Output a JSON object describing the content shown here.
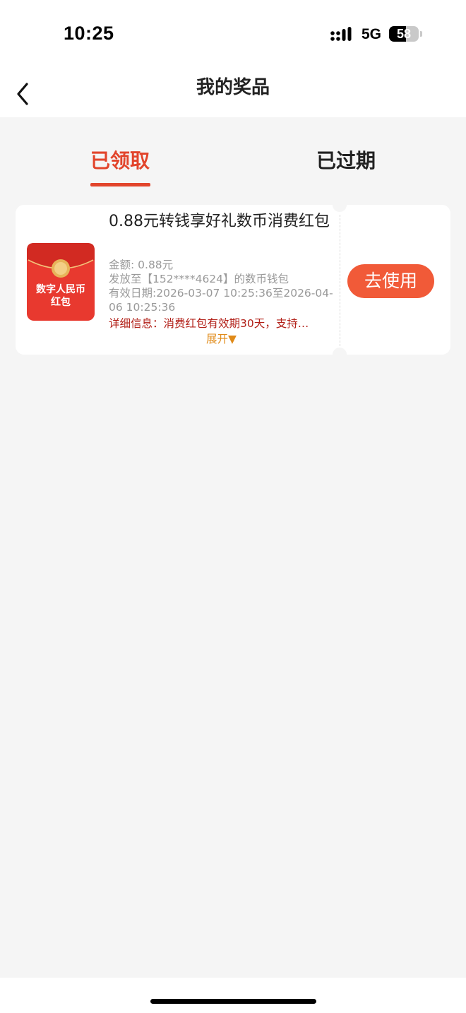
{
  "status_bar": {
    "time": "10:25",
    "network": "5G",
    "battery_level": "58",
    "battery_fraction": 0.58,
    "signal_icon": "signal-bars-icon"
  },
  "nav": {
    "back_icon": "chevron-left-icon",
    "title": "我的奖品"
  },
  "tabs": [
    {
      "label": "已领取",
      "active": true
    },
    {
      "label": "已过期",
      "active": false
    }
  ],
  "coupon": {
    "image_label_line1": "数字人民币",
    "image_label_line2": "红包",
    "title": "0.88元转钱享好礼数币消费红包",
    "amount": "金额: 0.88元",
    "wallet": "发放至【152****4624】的数币钱包",
    "validity": "有效日期:2026-03-07 10:25:36至2026-04-06 10:25:36",
    "detail": "详细信息：消费红包有效期30天，支持…",
    "expand_label": "展开▼",
    "use_button": "去使用"
  },
  "colors": {
    "accent": "#e2452c",
    "button": "#f15a38",
    "detail_text": "#b22018",
    "expand_text": "#e08a18",
    "background": "#f5f5f5"
  }
}
